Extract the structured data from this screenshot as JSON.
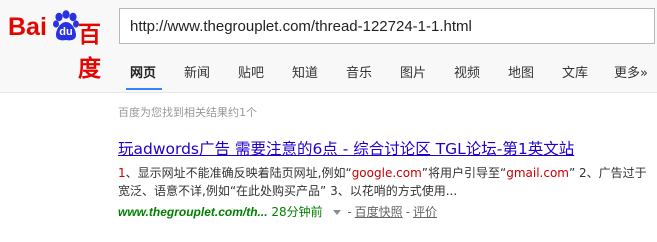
{
  "logo": {
    "text_left": "Bai",
    "text_mid": "du",
    "text_right": "百度"
  },
  "search": {
    "value": "http://www.thegrouplet.com/thread-122724-1-1.html"
  },
  "tabs": [
    {
      "label": "网页",
      "active": true
    },
    {
      "label": "新闻"
    },
    {
      "label": "贴吧"
    },
    {
      "label": "知道"
    },
    {
      "label": "音乐"
    },
    {
      "label": "图片"
    },
    {
      "label": "视频"
    },
    {
      "label": "地图"
    },
    {
      "label": "文库"
    },
    {
      "label": "更多»"
    }
  ],
  "stats": "百度为您找到相关结果约1个",
  "result": {
    "title": "玩adwords广告 需要注意的6点 - 综合讨论区 TGL论坛-第1英文站",
    "snippet": {
      "p1": "1",
      "p2": "、显示网址不能准确反映着陆页网址,例如“",
      "p3": "google.com",
      "p4": "”将用户引导至“",
      "p5": "gmail.com",
      "p6": "” 2、广告过于宽泛、语意不详,例如“在此处购买产品” 3、以花哨的方式使用..."
    },
    "url": "www.thegrouplet.com/th...",
    "time": "28分钟前",
    "sep": "-",
    "cache": "百度快照",
    "sep2": "-",
    "review": "评价"
  },
  "colors": {
    "brand_red": "#e10601",
    "paw_blue": "#2932e1",
    "title_link": "#2200cc",
    "url_green": "#008000",
    "tab_active": "#3385ff"
  }
}
